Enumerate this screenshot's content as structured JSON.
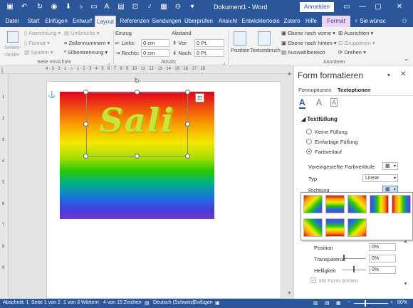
{
  "window": {
    "title": "Dokument1 - Word",
    "signin": "Anmelden"
  },
  "tabs": [
    "Datei",
    "Start",
    "Einfügen",
    "Entwurf",
    "Layout",
    "Referenzen",
    "Sendungen",
    "Überprüfen",
    "Ansicht",
    "Entwicklertools",
    "Zotero",
    "Hilfe",
    "Format"
  ],
  "tell_me": "Sie wünsc",
  "ribbon": {
    "seiten": "Seiten-",
    "raender": "ränder",
    "ausrichtung": "Ausrichtung",
    "format": "Format",
    "spalten": "Spalten",
    "umbrueche": "Umbrüche",
    "zeilennummern": "Zeilennummern",
    "silbentrennung": "Silbentrennung",
    "einzug": "Einzug",
    "abstand": "Abstand",
    "links_label": "Links:",
    "links_value": "0 cm",
    "rechts_label": "Rechts:",
    "rechts_value": "0 cm",
    "vor_label": "Vor:",
    "vor_value": "0 Pt.",
    "nach_label": "Nach:",
    "nach_value": "0 Pt.",
    "position": "Position",
    "textumbruch": "Textumbruch",
    "ebene_vorne": "Ebene nach vorne",
    "ebene_hinten": "Ebene nach hinten",
    "auswahlbereich": "Auswahlbereich",
    "ausrichten": "Ausrichten",
    "gruppieren": "Gruppieren",
    "drehen": "Drehen",
    "group_seite": "Seite einrichten",
    "group_absatz": "Absatz",
    "group_anordnen": "Anordnen"
  },
  "document": {
    "wordart": "Sali"
  },
  "pane": {
    "title": "Form formatieren",
    "tab_form": "Formoptionen",
    "tab_text": "Textoptionen",
    "section": "Textfüllung",
    "opt_none": "Keine Füllung",
    "opt_solid": "Einfarbige Füllung",
    "opt_gradient": "Farbverlauf",
    "preset_label": "Voreingestellte Farbverläufe",
    "typ_label": "Typ",
    "typ_value": "Linear",
    "richtung_label": "Richtung",
    "position_label": "Position",
    "position_value": "0%",
    "transparenz_label": "Transparenz",
    "transparenz_value": "0%",
    "helligkeit_label": "Helligkeit",
    "helligkeit_value": "0%",
    "rotate_label": "Mit Form drehen"
  },
  "status": {
    "section": "Abschnitt: 1",
    "page": "Seite 1 von 2",
    "words_selected": "1 von 3 Wörtern",
    "chars": "4 von 15 Zeichen",
    "language": "Deutsch (Schweiz)",
    "mode": "Einfügen",
    "zoom": "60%"
  },
  "colors": {
    "brand": "#2b579a",
    "format_tab": "#e8d7f2"
  }
}
